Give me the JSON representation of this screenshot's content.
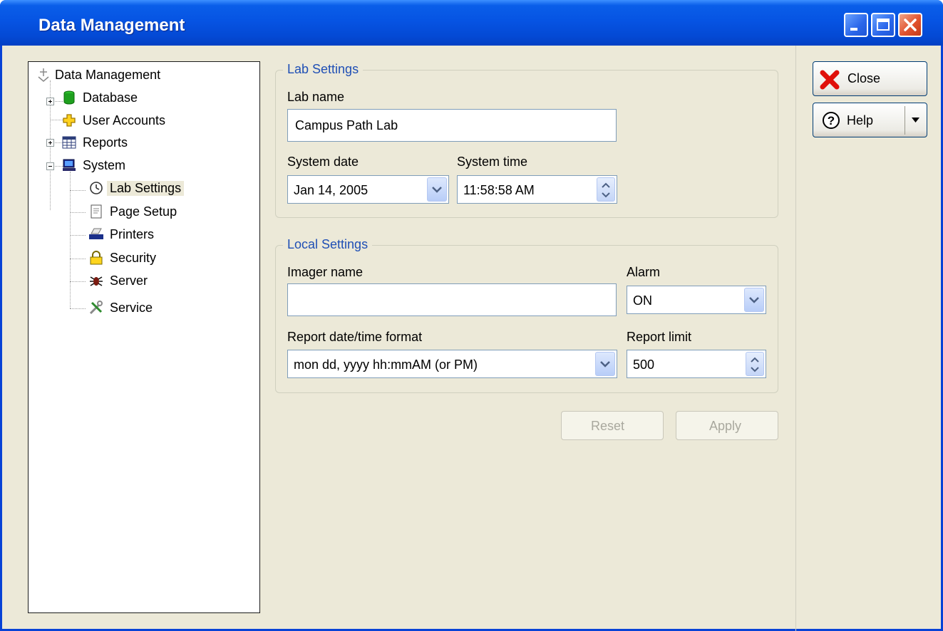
{
  "window": {
    "title": "Data Management"
  },
  "tree": {
    "root": "Data Management",
    "items": [
      {
        "label": "Database",
        "icon": "database-icon"
      },
      {
        "label": "User Accounts",
        "icon": "user-accounts-icon"
      },
      {
        "label": "Reports",
        "icon": "reports-icon"
      },
      {
        "label": "System",
        "icon": "computer-icon"
      }
    ],
    "system_children": [
      {
        "label": "Lab Settings",
        "icon": "clock-icon"
      },
      {
        "label": "Page Setup",
        "icon": "page-icon"
      },
      {
        "label": "Printers",
        "icon": "printer-icon"
      },
      {
        "label": "Security",
        "icon": "lock-icon"
      },
      {
        "label": "Server",
        "icon": "bug-icon"
      },
      {
        "label": "Service",
        "icon": "tools-icon"
      }
    ]
  },
  "lab_settings": {
    "title": "Lab Settings",
    "lab_name_label": "Lab name",
    "lab_name_value": "Campus Path Lab",
    "system_date_label": "System date",
    "system_date_value": "Jan 14, 2005",
    "system_time_label": "System time",
    "system_time_value": "11:58:58 AM"
  },
  "local_settings": {
    "title": "Local Settings",
    "imager_name_label": "Imager name",
    "imager_name_value": "",
    "alarm_label": "Alarm",
    "alarm_value": "ON",
    "report_format_label": "Report date/time format",
    "report_format_value": "mon dd, yyyy hh:mmAM (or PM)",
    "report_limit_label": "Report limit",
    "report_limit_value": "500"
  },
  "actions": {
    "reset": "Reset",
    "apply": "Apply"
  },
  "side_buttons": {
    "close": "Close",
    "help": "Help"
  }
}
